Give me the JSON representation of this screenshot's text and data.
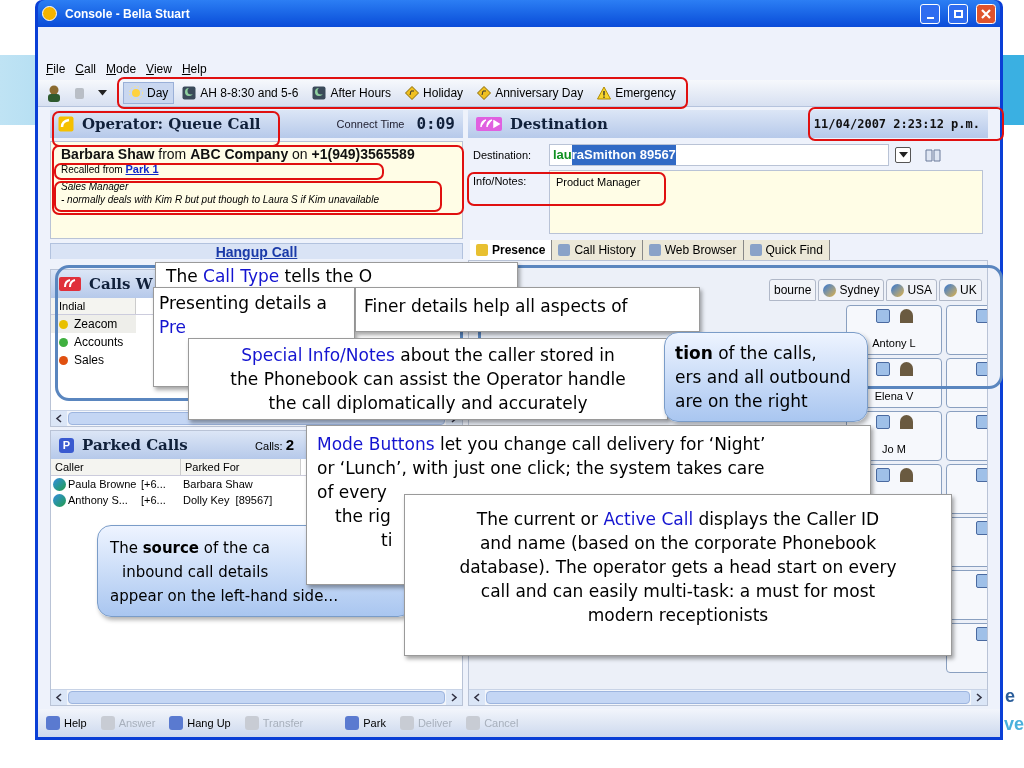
{
  "window": {
    "title": "Console - Bella Stuart"
  },
  "menu": [
    "File",
    "Call",
    "Mode",
    "View",
    "Help"
  ],
  "mode_buttons": [
    {
      "label": "Day",
      "selected": true,
      "kind": "sun"
    },
    {
      "label": "AH 8-8:30 and 5-6",
      "selected": false,
      "kind": "moon"
    },
    {
      "label": "After Hours",
      "selected": false,
      "kind": "moon"
    },
    {
      "label": "Holiday",
      "selected": false,
      "kind": "sign"
    },
    {
      "label": "Anniversary Day",
      "selected": false,
      "kind": "sign"
    },
    {
      "label": "Emergency",
      "selected": false,
      "kind": "warning"
    }
  ],
  "operator": {
    "title": "Operator: Queue Call",
    "connect_label": "Connect Time",
    "connect_time": "0:09",
    "caller_line": "**Barbara Shaw**  from **ABC Company** on **+1(949)3565589**",
    "recalled": "Recalled from",
    "park_link": "Park 1",
    "notes": [
      "Sales Manager",
      "- normally deals with Kim R but put though to Laura S if Kim unavailable"
    ],
    "hangup": "Hangup Call"
  },
  "calls_waiting": {
    "title": "Calls W",
    "columns": [
      "Indial"
    ],
    "rows": [
      {
        "name": "Zeacom",
        "color": "#e8c000",
        "selected": true
      },
      {
        "name": "Accounts",
        "color": "#40b040",
        "selected": false
      },
      {
        "name": "Sales",
        "color": "#e05010",
        "selected": false
      }
    ]
  },
  "parked": {
    "icon_label": "P",
    "title": "Parked Calls",
    "count_label": "Calls:",
    "count": "2",
    "columns": [
      "Caller",
      "Parked For"
    ],
    "rows": [
      {
        "caller": "Paula Browne",
        "number": "[+6...",
        "parked_for": "Barbara Shaw"
      },
      {
        "caller": "Anthony S...",
        "number": "[+6...",
        "parked_for": "Dolly Key  [89567]"
      }
    ]
  },
  "bottom_toolbar": [
    {
      "label": "Help",
      "disabled": false
    },
    {
      "label": "Answer",
      "disabled": true
    },
    {
      "label": "Hang Up",
      "disabled": false
    },
    {
      "label": "Transfer",
      "disabled": true
    },
    {
      "label": "Park",
      "disabled": false
    },
    {
      "label": "Deliver",
      "disabled": true
    },
    {
      "label": "Cancel",
      "disabled": true
    }
  ],
  "destination": {
    "title": "Destination",
    "datetime": "11/04/2007 2:23:12 p.m.",
    "dest_label": "Destination:",
    "typed": "lau",
    "completion": "raSmithon 89567",
    "notes_label": "Info/Notes:",
    "notes": "Product Manager"
  },
  "tabs": [
    {
      "label": "Presence",
      "selected": true
    },
    {
      "label": "Call History",
      "selected": false
    },
    {
      "label": "Web Browser",
      "selected": false
    },
    {
      "label": "Quick Find",
      "selected": false
    }
  ],
  "locations": [
    {
      "label": "bourne",
      "selected": false
    },
    {
      "label": "Sydney",
      "selected": false
    },
    {
      "label": "USA",
      "selected": false
    },
    {
      "label": "UK",
      "selected": false
    }
  ],
  "presence": [
    {
      "name": "Antony L"
    },
    {
      "name": "Elena V"
    },
    {
      "name": "Jo M"
    }
  ],
  "callouts": [
    {
      "kind": "white",
      "lines": [
        [
          {
            "text": "The "
          },
          {
            "text": "Call Type",
            "accent": true
          },
          {
            "text": " tells the O"
          }
        ]
      ]
    },
    {
      "kind": "white",
      "lines": [
        [
          {
            "text": "Presenting details a"
          }
        ],
        [
          {
            "text": "Pre",
            "accent": true
          }
        ]
      ]
    },
    {
      "kind": "white",
      "lines": [
        [
          {
            "text": "Finer details help all aspects of"
          }
        ]
      ]
    },
    {
      "kind": "white",
      "lines": [
        [
          {
            "text": "Special Info/Notes",
            "accent": true
          },
          {
            "text": " about the caller stored in"
          }
        ],
        [
          {
            "text": "the Phonebook can assist the Operator handle"
          }
        ],
        [
          {
            "text": "the call diplomatically and accurately"
          }
        ]
      ]
    },
    {
      "kind": "blue",
      "lines": [
        [
          {
            "text": "tion",
            "bold": true
          },
          {
            "text": " of the calls,"
          }
        ],
        [
          {
            "text": "ers and all outbound"
          }
        ],
        [
          {
            "text": "are on the right"
          }
        ]
      ]
    },
    {
      "kind": "blue",
      "lines": [
        [
          {
            "text": "The "
          },
          {
            "text": "source",
            "bold": true
          },
          {
            "text": " of the ca"
          }
        ],
        [
          {
            "text": "inbound call details"
          }
        ],
        [
          {
            "text": "appear on the left-hand side…"
          }
        ]
      ]
    },
    {
      "kind": "white",
      "lines": [
        [
          {
            "text": "Mode Buttons",
            "accent": true
          },
          {
            "text": " let you change call delivery for ‘Night’"
          }
        ],
        [
          {
            "text": "or ‘Lunch’, with just one click; the system takes care"
          }
        ],
        [
          {
            "text": "of every"
          }
        ],
        [
          {
            "text": "the rig"
          }
        ],
        [
          {
            "text": "ti"
          }
        ]
      ]
    },
    {
      "kind": "white",
      "lines": [
        [
          {
            "text": "The current or "
          },
          {
            "text": "Active Call",
            "accent": true
          },
          {
            "text": " displays the Caller ID"
          }
        ],
        [
          {
            "text": "and name (based on the corporate Phonebook"
          }
        ],
        [
          {
            "text": "database). The operator gets a head start on every"
          }
        ],
        [
          {
            "text": "call and can easily multi-task: a must for most"
          }
        ],
        [
          {
            "text": "modern receptionists"
          }
        ]
      ]
    }
  ],
  "slide_logo": [
    "e",
    "ve"
  ]
}
